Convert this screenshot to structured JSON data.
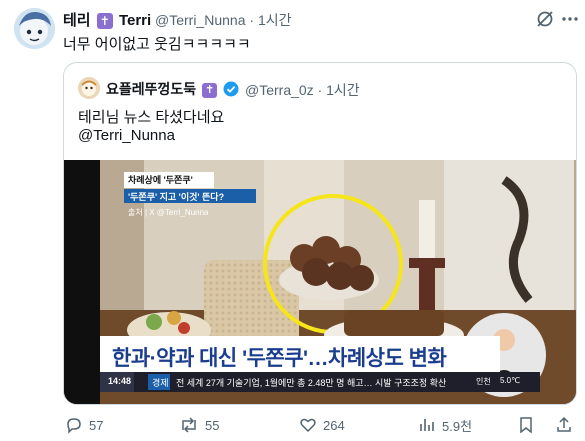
{
  "tweet": {
    "author_name": "테리",
    "author_handle": "@Terri_Nunna",
    "separator": "·",
    "time": "1시간",
    "text": "너무 어이없고 웃김ㅋㅋㅋㅋㅋ",
    "name_latin": "Terri"
  },
  "quote": {
    "author_name": "요플레뚜껑도둑",
    "author_handle": "@Terra_0z",
    "separator": "·",
    "time": "1시간",
    "text_line1": "테리님 뉴스 타셨다네요",
    "text_line2": "@Terri_Nunna",
    "media": {
      "headline": "한과·약과 대신 '두쫀쿠'…차례상도 변화",
      "sub_title_line1": "차례상에 '두쫀쿠'",
      "sub_title_line2": "'두쫀쿠' 지고 '이것' 뜬다?",
      "source": "출처 | X @Terri_Nunna",
      "ticker_time": "14:48",
      "ticker_section": "경제",
      "ticker_text": "전 세계 27개 기술기업, 1월에만 총 2.48만 명 해고… 시발 구조조정 확산",
      "ticker_region": "인천",
      "ticker_temp": "5.0℃"
    }
  },
  "actions": {
    "replies": "57",
    "reposts": "55",
    "likes": "264",
    "views": "5.9천"
  },
  "colors": {
    "accent": "#1d9bf0",
    "muted": "#536471",
    "verified_badge": "#8a6fd1",
    "headline_blue": "#1b3d8f"
  }
}
